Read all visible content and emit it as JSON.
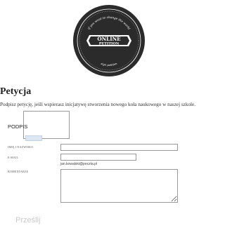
{
  "logo": {
    "top_text": "if you want to change the world",
    "line1": "ONLINE",
    "line2": "PETITION",
    "bottom_text": "sign petition"
  },
  "page": {
    "title": "Petycja",
    "description": "Podpisz petycję, jeśli wspierasz inicjatywę stworzenia nowego koła naukowego w naszej szkole."
  },
  "form": {
    "signature_label": "PODPIS",
    "name_label": "IMIĘ I NAZWISKO",
    "name_value": "",
    "email_label": "E-MAIL",
    "email_value": "",
    "email_hint": "jan.kowalski@poczta.pl",
    "comment_label": "KOMENTARZE",
    "comment_value": "",
    "submit_label": "Prześlij"
  },
  "colors": {
    "seal_dark": "#2b2b2b",
    "seal_light": "#ffffff",
    "submit_text": "#c9c9c9",
    "clear_button": "#dde6f3"
  }
}
